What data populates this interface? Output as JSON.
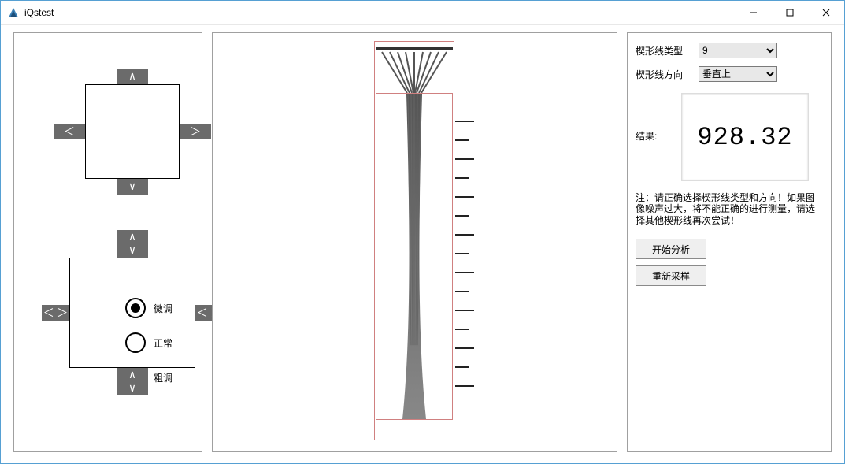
{
  "window": {
    "title": "iQstest"
  },
  "dpad": {
    "up": "∧",
    "down": "∨",
    "left": "＜",
    "right": "＞"
  },
  "tune": {
    "fine": "微调",
    "normal": "正常",
    "coarse": "粗调"
  },
  "form": {
    "type_label": "楔形线类型",
    "type_value": "9",
    "dir_label": "楔形线方向",
    "dir_value": "垂直上"
  },
  "result": {
    "label": "结果:",
    "value": "928.32"
  },
  "note": "注：请正确选择楔形线类型和方向！如果图像噪声过大，将不能正确的进行测量，请选择其他楔形线再次尝试！",
  "buttons": {
    "analyze": "开始分析",
    "resample": "重新采样"
  }
}
